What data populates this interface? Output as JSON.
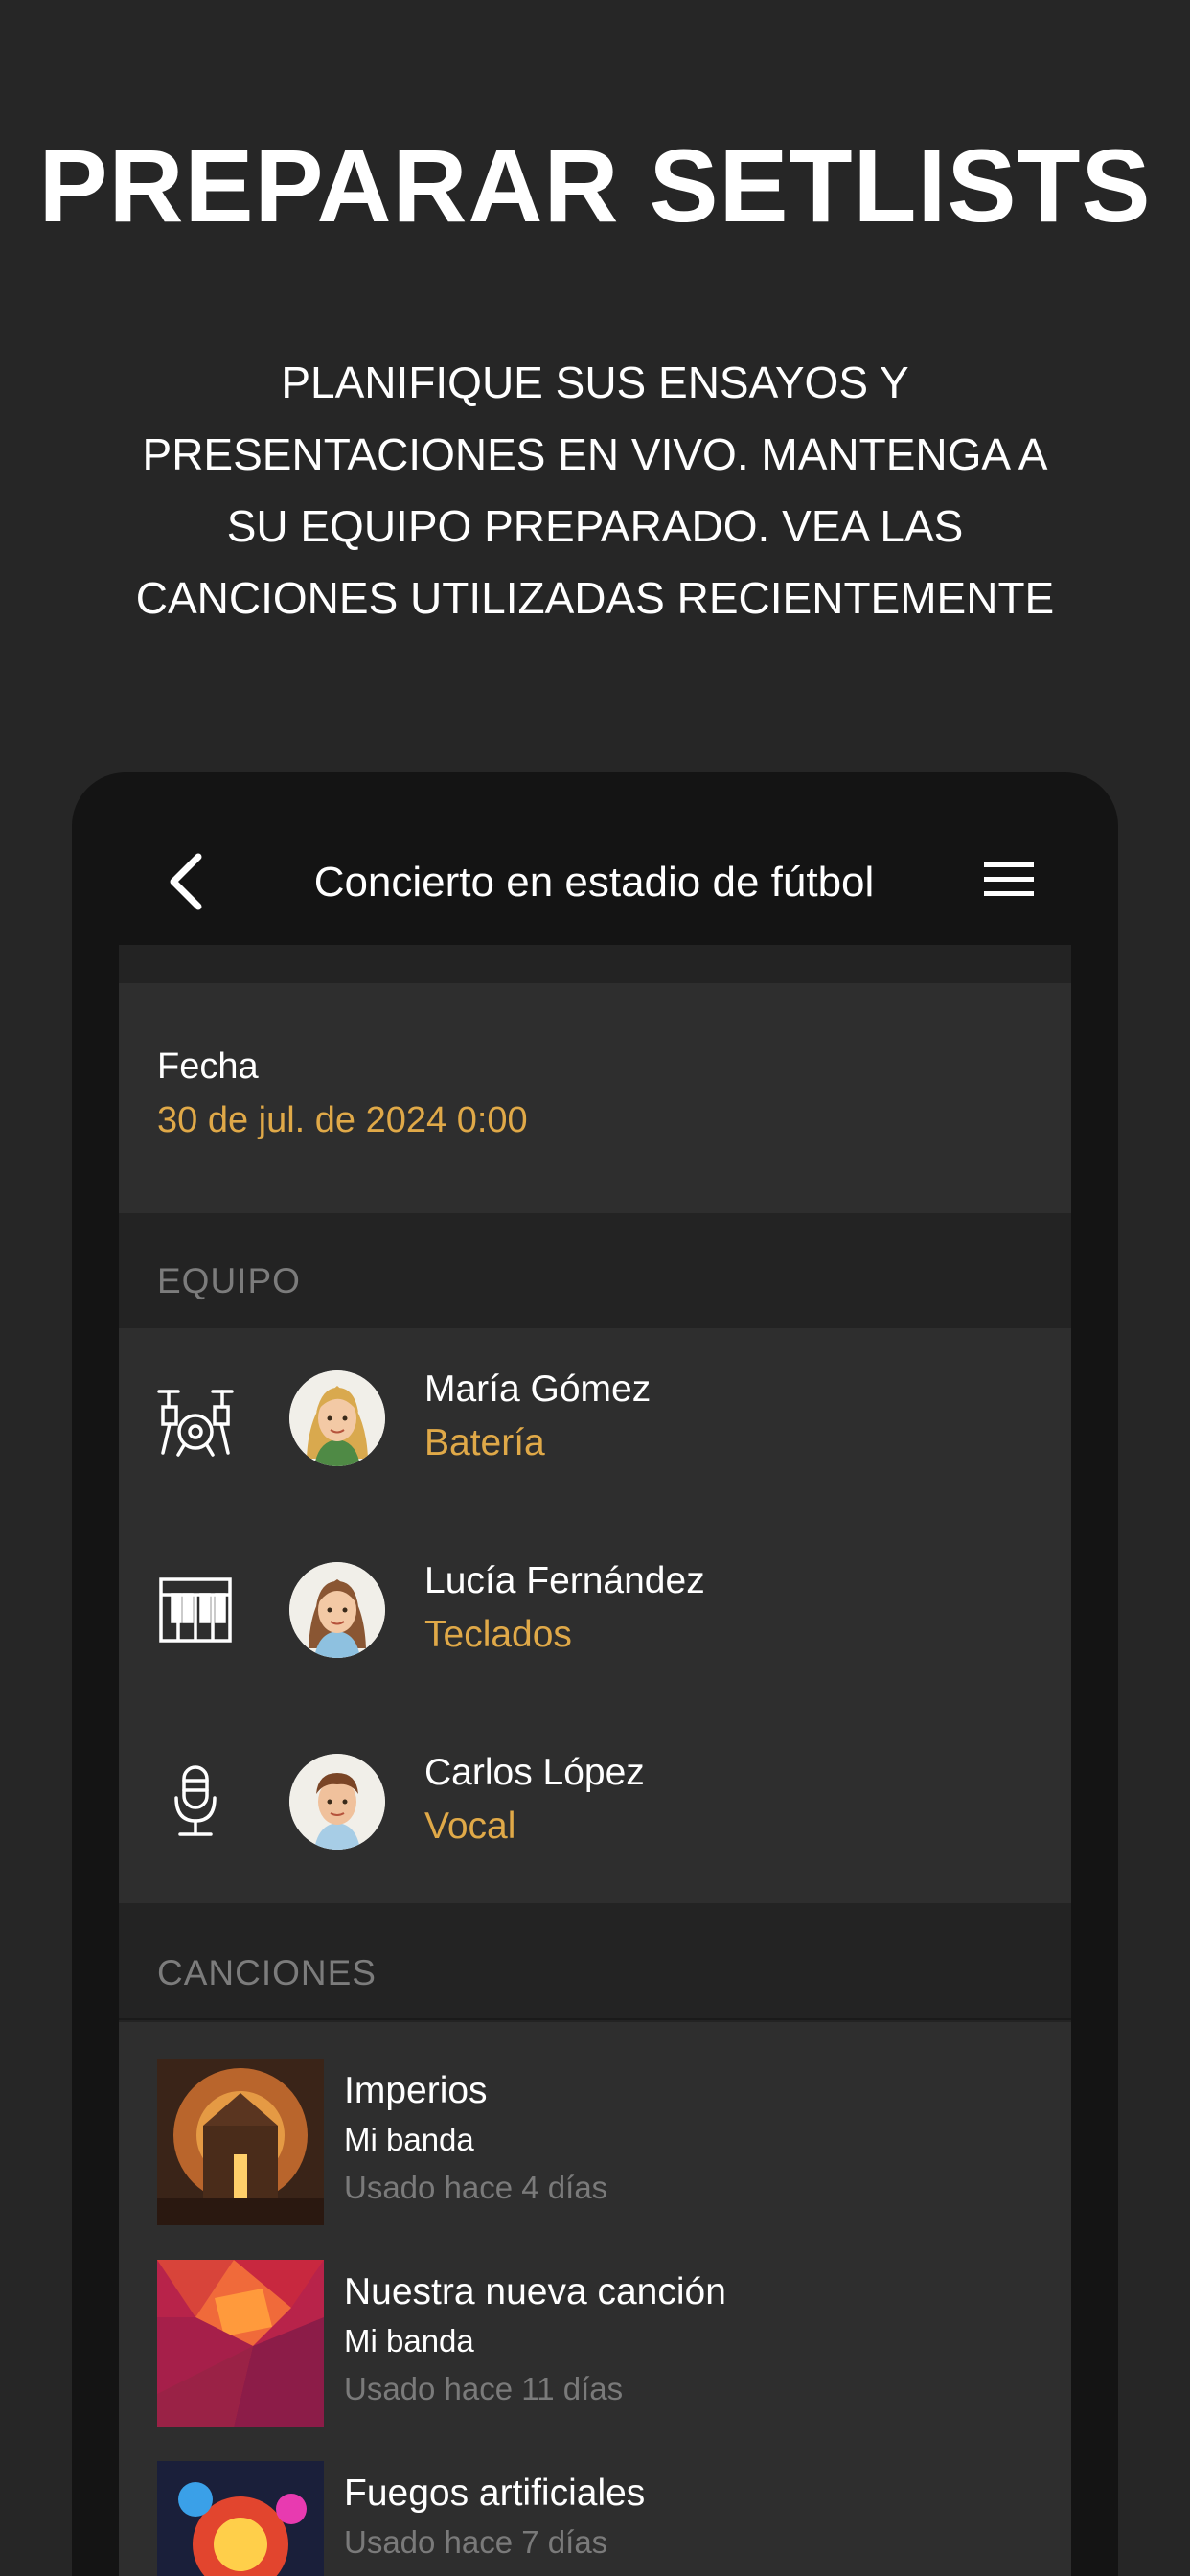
{
  "promo": {
    "headline": "PREPARAR SETLISTS",
    "subtitle_lines": [
      "PLANIFIQUE SUS ENSAYOS Y",
      "PRESENTACIONES EN VIVO. MANTENGA A",
      "SU EQUIPO PREPARADO. VEA LAS",
      "CANCIONES UTILIZADAS RECIENTEMENTE"
    ]
  },
  "navbar": {
    "back_icon": "chevron-left-icon",
    "title": "Concierto en estadio de fútbol",
    "menu_icon": "hamburger-menu-icon"
  },
  "date_card": {
    "label": "Fecha",
    "value": "30 de jul. de 2024 0:00"
  },
  "team": {
    "section_title": "EQUIPO",
    "members": [
      {
        "name": "María Gómez",
        "role": "Batería",
        "instrument_icon": "drum-kit-icon"
      },
      {
        "name": "Lucía Fernández",
        "role": "Teclados",
        "instrument_icon": "piano-keyboard-icon"
      },
      {
        "name": "Carlos López",
        "role": "Vocal",
        "instrument_icon": "microphone-icon"
      }
    ]
  },
  "songs": {
    "section_title": "CANCIONES",
    "items": [
      {
        "title": "Imperios",
        "artist": "Mi banda",
        "used": "Usado hace 4 días"
      },
      {
        "title": "Nuestra nueva canción",
        "artist": "Mi banda",
        "used": "Usado hace 11 días"
      },
      {
        "title": "Fuegos artificiales",
        "artist": "",
        "used": "Usado hace 7 días"
      }
    ]
  },
  "colors": {
    "background": "#262626",
    "phone_frame": "#141414",
    "card": "#2e2e2e",
    "accent": "#e0a948",
    "muted": "#7c7c7c"
  }
}
